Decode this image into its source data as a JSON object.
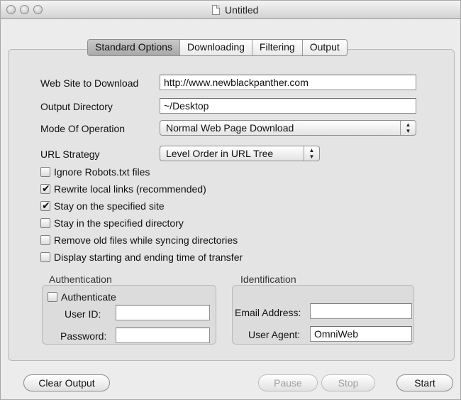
{
  "window": {
    "title": "Untitled"
  },
  "tabs": [
    "Standard Options",
    "Downloading",
    "Filtering",
    "Output"
  ],
  "form": {
    "website_label": "Web Site to Download",
    "website_value": "http://www.newblackpanther.com",
    "output_dir_label": "Output Directory",
    "output_dir_value": "~/Desktop",
    "mode_label": "Mode Of Operation",
    "mode_value": "Normal Web Page Download",
    "url_strategy_label": "URL Strategy",
    "url_strategy_value": "Level Order in URL Tree"
  },
  "options": [
    {
      "label": "Ignore Robots.txt files",
      "checked": false
    },
    {
      "label": "Rewrite local links (recommended)",
      "checked": true
    },
    {
      "label": "Stay on the specified site",
      "checked": true
    },
    {
      "label": "Stay in the specified directory",
      "checked": false
    },
    {
      "label": "Remove old files while syncing directories",
      "checked": false
    },
    {
      "label": "Display starting and ending time of transfer",
      "checked": false
    }
  ],
  "authentication": {
    "title": "Authentication",
    "checkbox_label": "Authenticate",
    "checked": false,
    "user_id_label": "User ID:",
    "user_id_value": "",
    "password_label": "Password:",
    "password_value": ""
  },
  "identification": {
    "title": "Identification",
    "email_label": "Email Address:",
    "email_value": "",
    "agent_label": "User Agent:",
    "agent_value": "OmniWeb"
  },
  "buttons": {
    "clear_output": "Clear Output",
    "pause": "Pause",
    "stop": "Stop",
    "start": "Start"
  }
}
